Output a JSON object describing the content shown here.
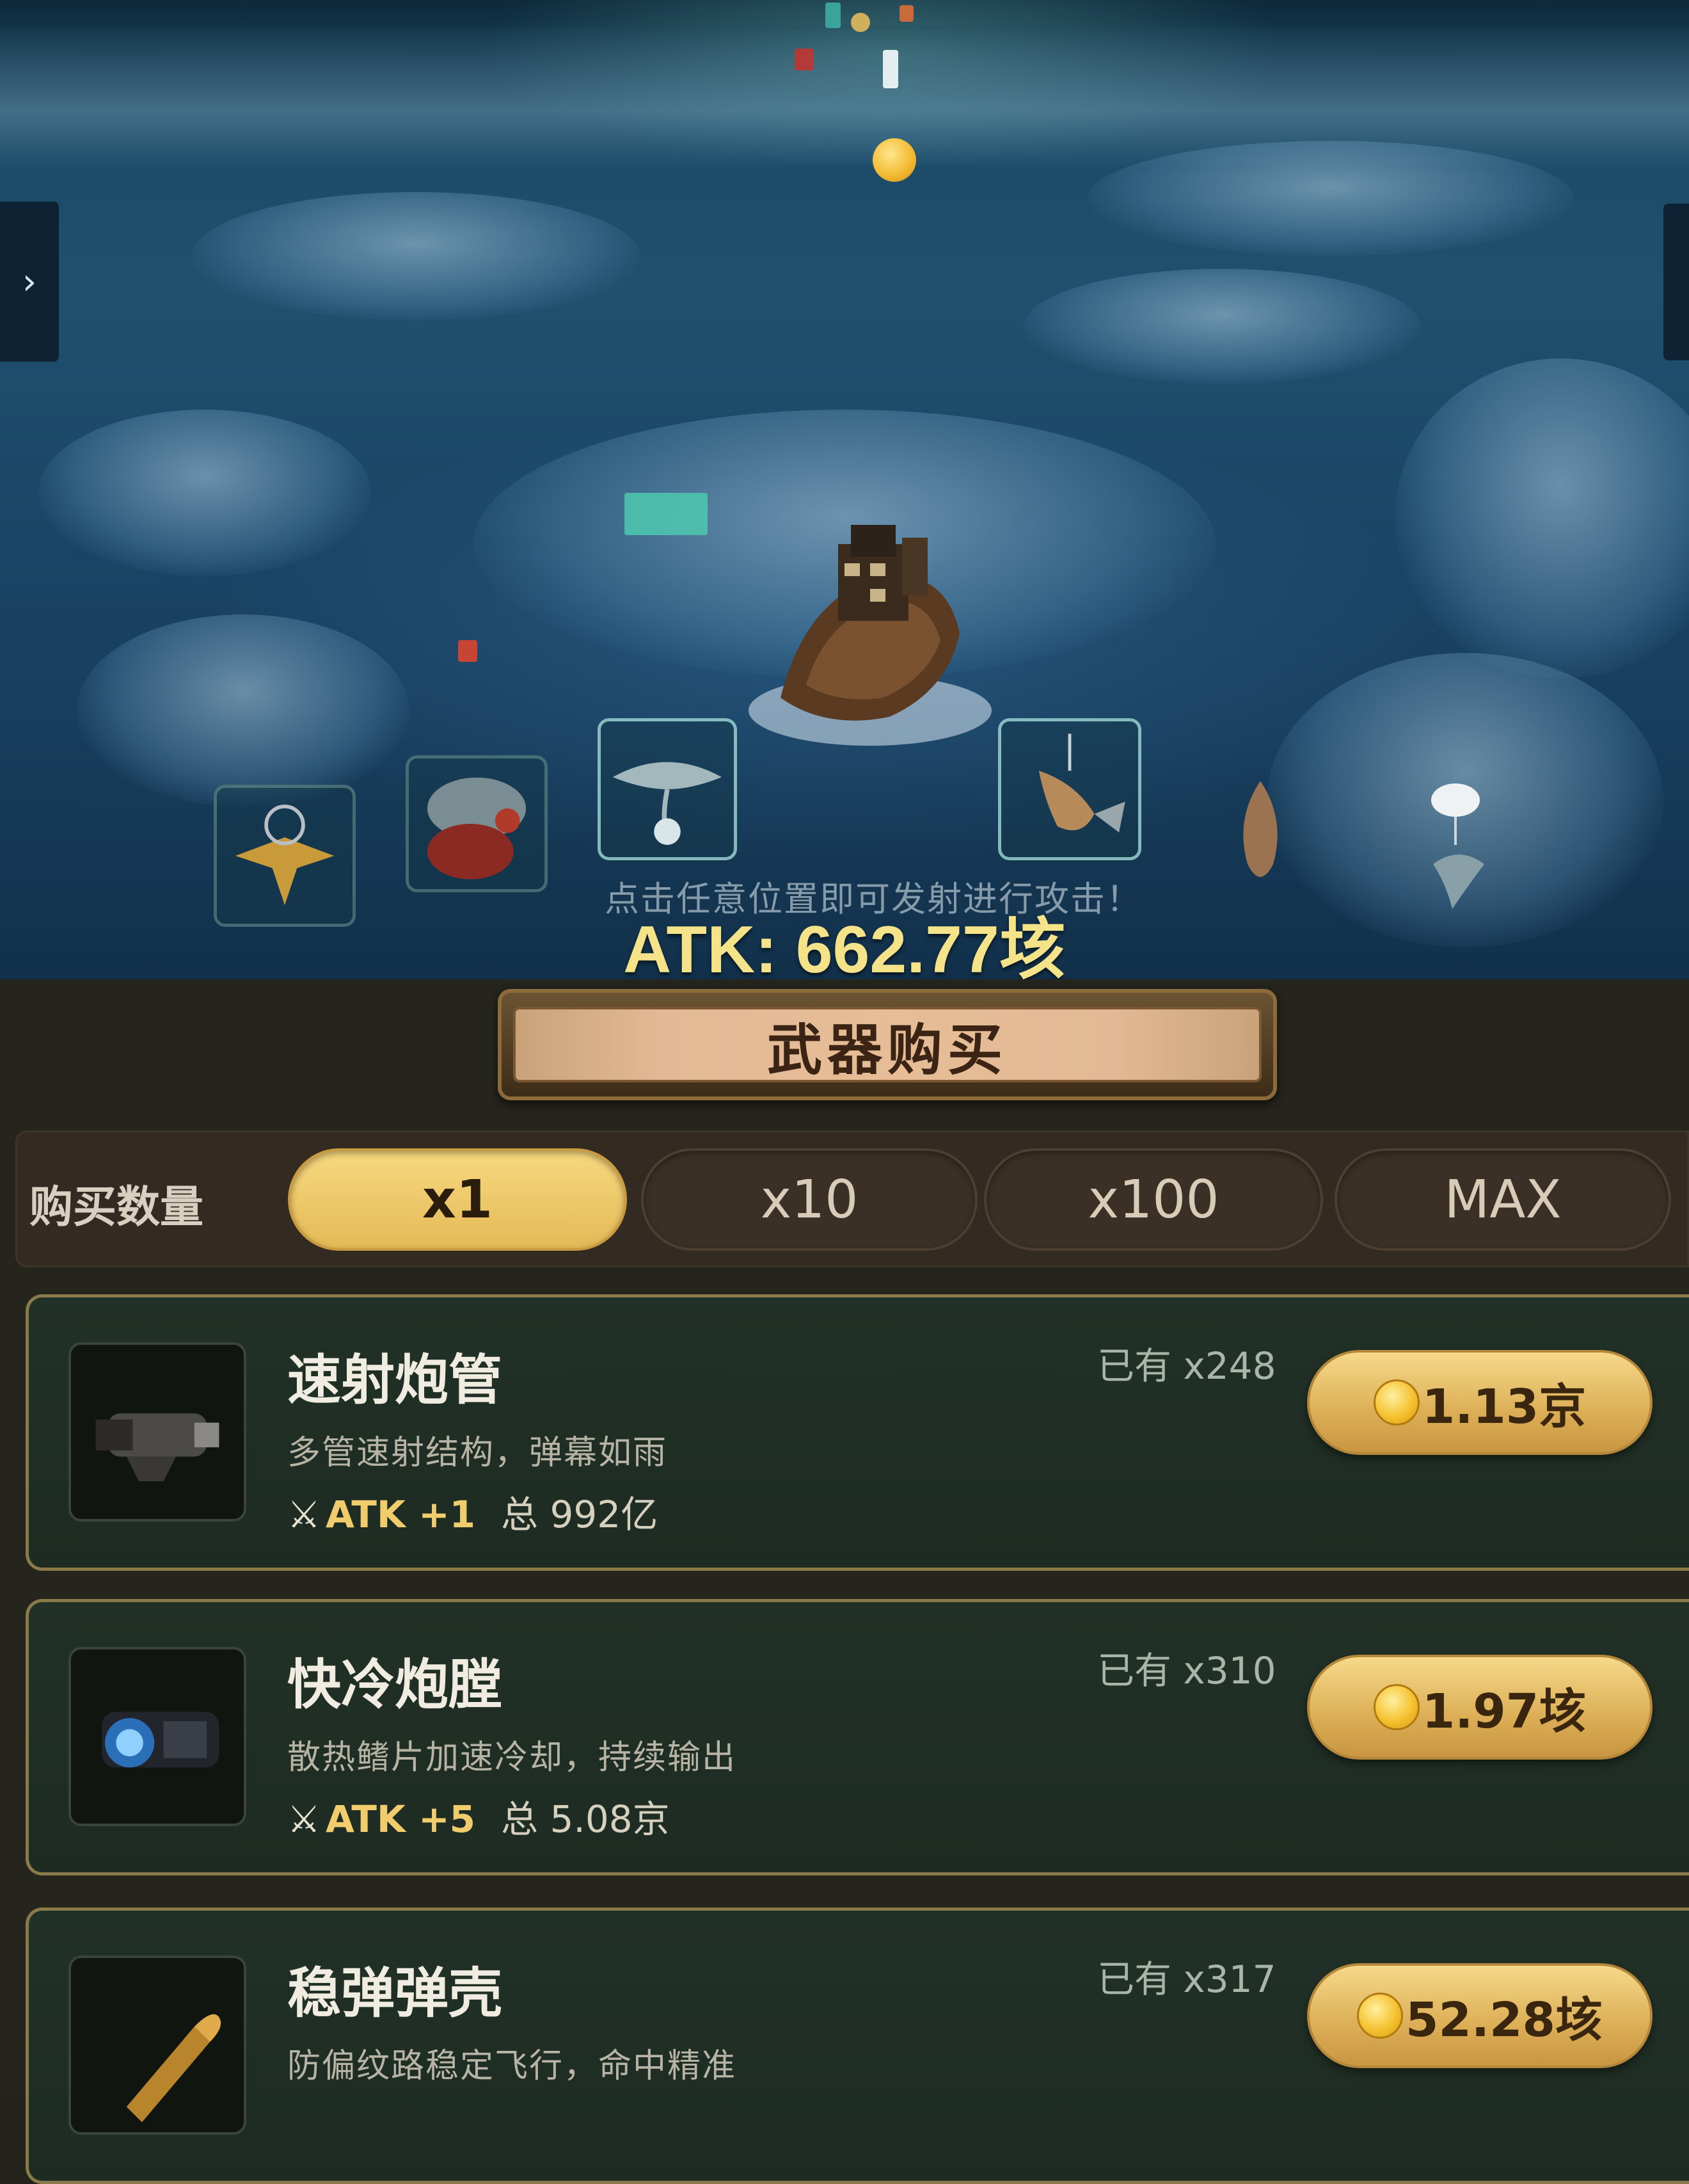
{
  "scene": {
    "side_tab_left_arrow": "›",
    "hint_text": "点击任意位置即可发射进行攻击！",
    "atk_text": "ATK: 662.77垓"
  },
  "shop": {
    "title": "武器购买",
    "quantity_label": "购买数量",
    "quantity_options": [
      "x1",
      "x10",
      "x100",
      "MAX"
    ],
    "selected_quantity": "x1",
    "items": [
      {
        "name": "速射炮管",
        "icon": "cannon-barrel-icon",
        "description": "多管速射结构，弹幕如雨",
        "atk_bonus": "ATK +1",
        "total": "总 992亿",
        "owned": "已有 x248",
        "price": "1.13京"
      },
      {
        "name": "快冷炮膛",
        "icon": "cooling-chamber-icon",
        "description": "散热鳍片加速冷却，持续输出",
        "atk_bonus": "ATK +5",
        "total": "总 5.08京",
        "owned": "已有 x310",
        "price": "1.97垓"
      },
      {
        "name": "稳弹弹壳",
        "icon": "bullet-shell-icon",
        "description": "防偏纹路稳定飞行，命中精准",
        "atk_bonus": "",
        "total": "",
        "owned": "已有 x317",
        "price": "52.28垓"
      }
    ]
  },
  "colors": {
    "accent_gold": "#e4b957",
    "atk_text": "#f5e38a",
    "panel_bg": "#25241d",
    "item_border": "#8a7a4a"
  }
}
